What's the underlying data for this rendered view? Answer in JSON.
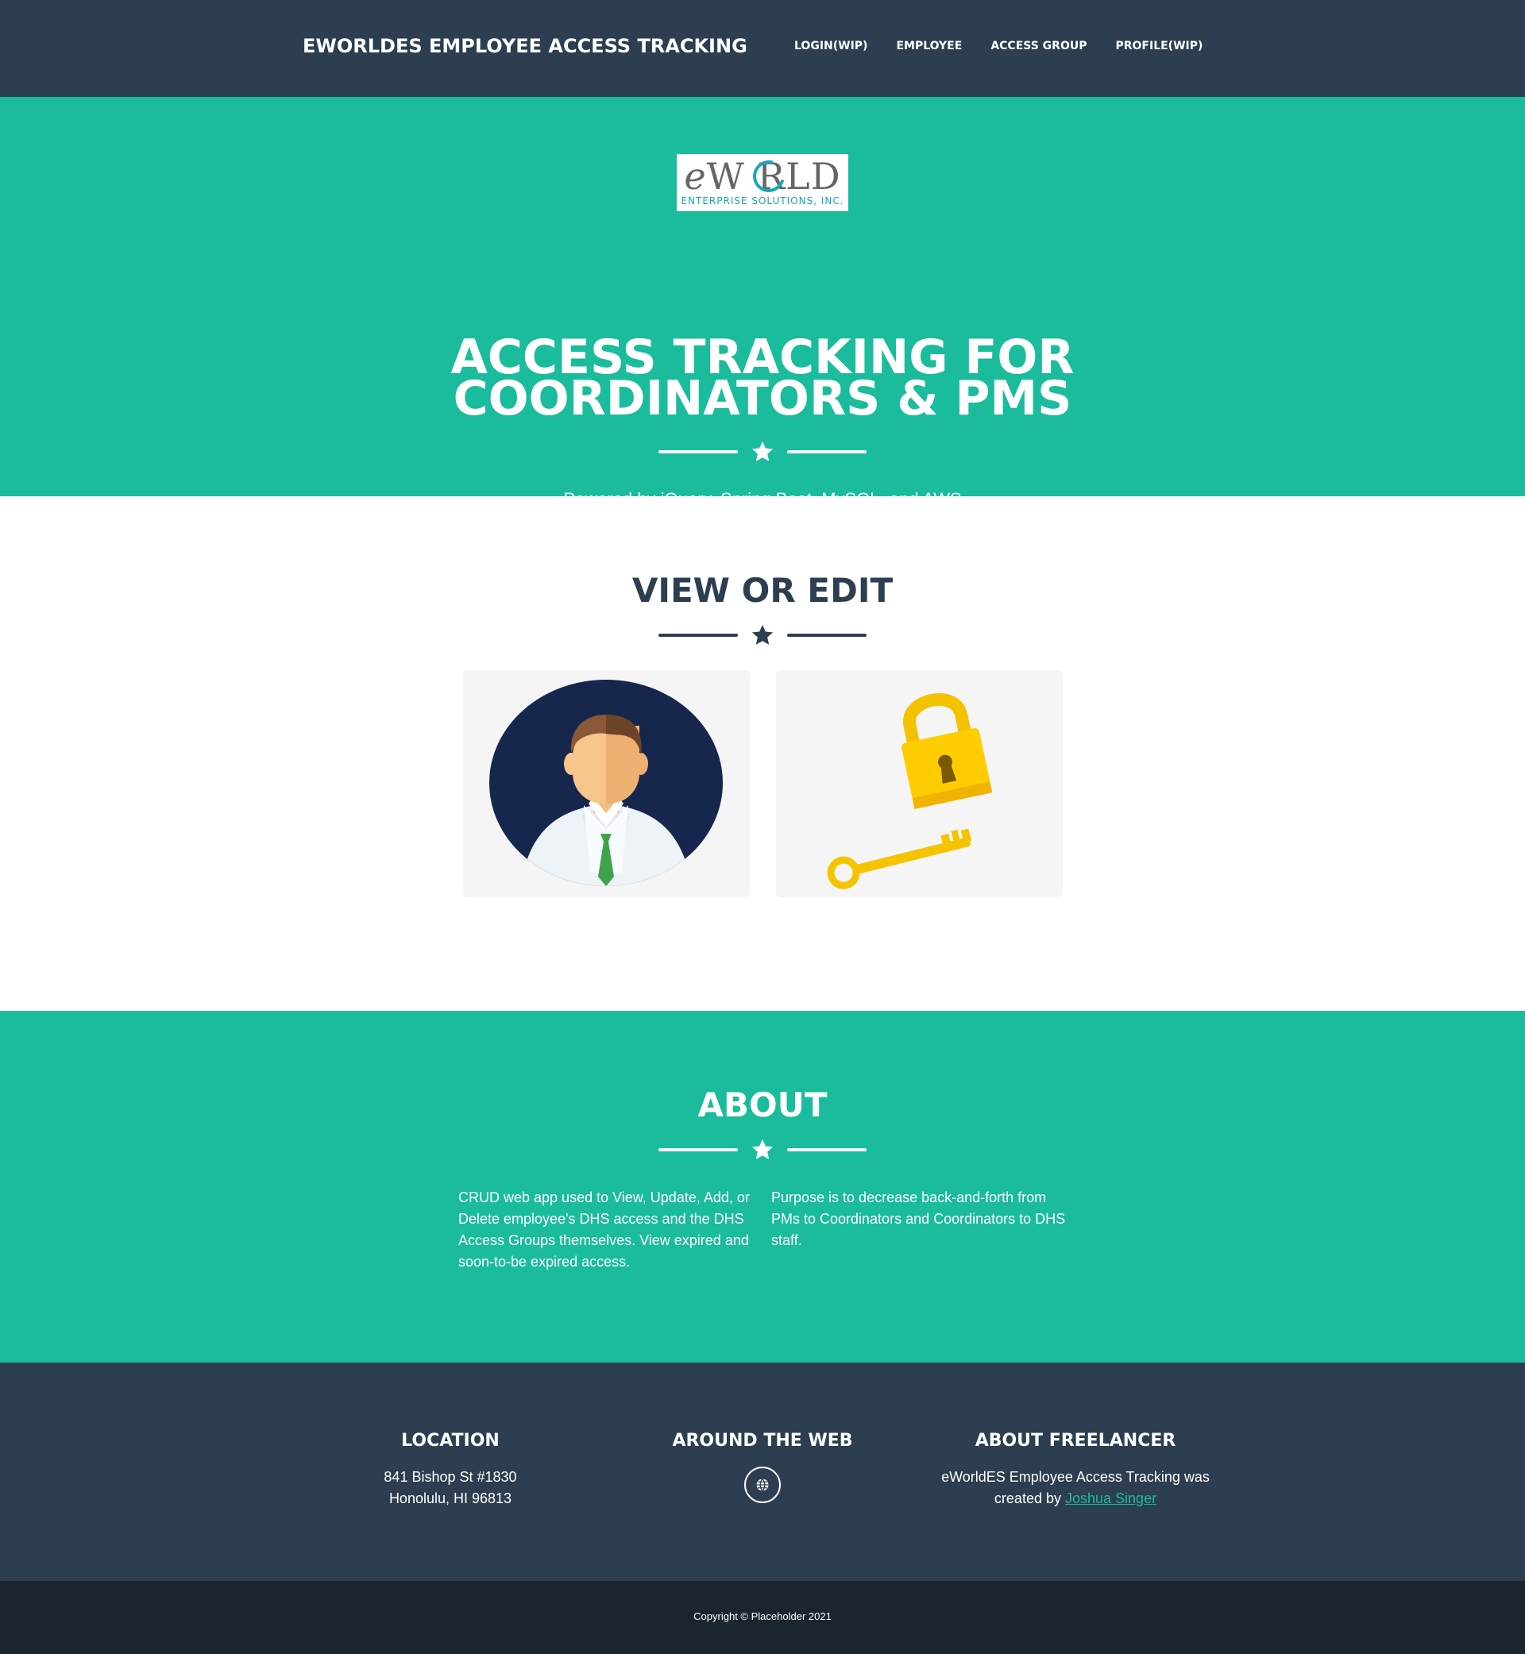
{
  "navbar": {
    "brand": "EWORLDES EMPLOYEE ACCESS TRACKING",
    "links": [
      "LOGIN(WIP)",
      "EMPLOYEE",
      "ACCESS GROUP",
      "PROFILE(WIP)"
    ]
  },
  "masthead": {
    "logo_main_e": "e",
    "logo_main_rest": "W RLD",
    "logo_sub": "ENTERPRISE SOLUTIONS, INC.",
    "title_line1": "ACCESS TRACKING FOR",
    "title_line2": "COORDINATORS & PMS",
    "subtitle": "Powered by jQuery, Spring Boot, MySQL, and AWS"
  },
  "portfolio": {
    "heading": "VIEW OR EDIT",
    "cards": [
      {
        "icon": "employee-avatar-icon"
      },
      {
        "icon": "lock-and-key-icon"
      }
    ]
  },
  "about": {
    "heading": "ABOUT",
    "left_text": "CRUD web app used to View, Update, Add, or Delete employee's DHS access and the DHS Access Groups themselves. View expired and soon-to-be expired access.",
    "right_text": "Purpose is to decrease back-and-forth from PMs to Coordinators and Coordinators to DHS staff."
  },
  "footer": {
    "location_heading": "LOCATION",
    "address_line1": "841 Bishop St #1830",
    "address_line2": "Honolulu, HI 96813",
    "web_heading": "AROUND THE WEB",
    "web_icon": "globe-icon",
    "freelancer_heading": "ABOUT FREELANCER",
    "freelancer_text1": "eWorldES Employee Access Tracking was",
    "freelancer_text2": "created by",
    "freelancer_link": "Joshua Singer"
  },
  "copyright": "Copyright © Placeholder 2021",
  "colors": {
    "primary": "#1abc9c",
    "dark": "#2c3e50",
    "darker": "#1a252f",
    "logo_accent": "#1aa6b7"
  }
}
